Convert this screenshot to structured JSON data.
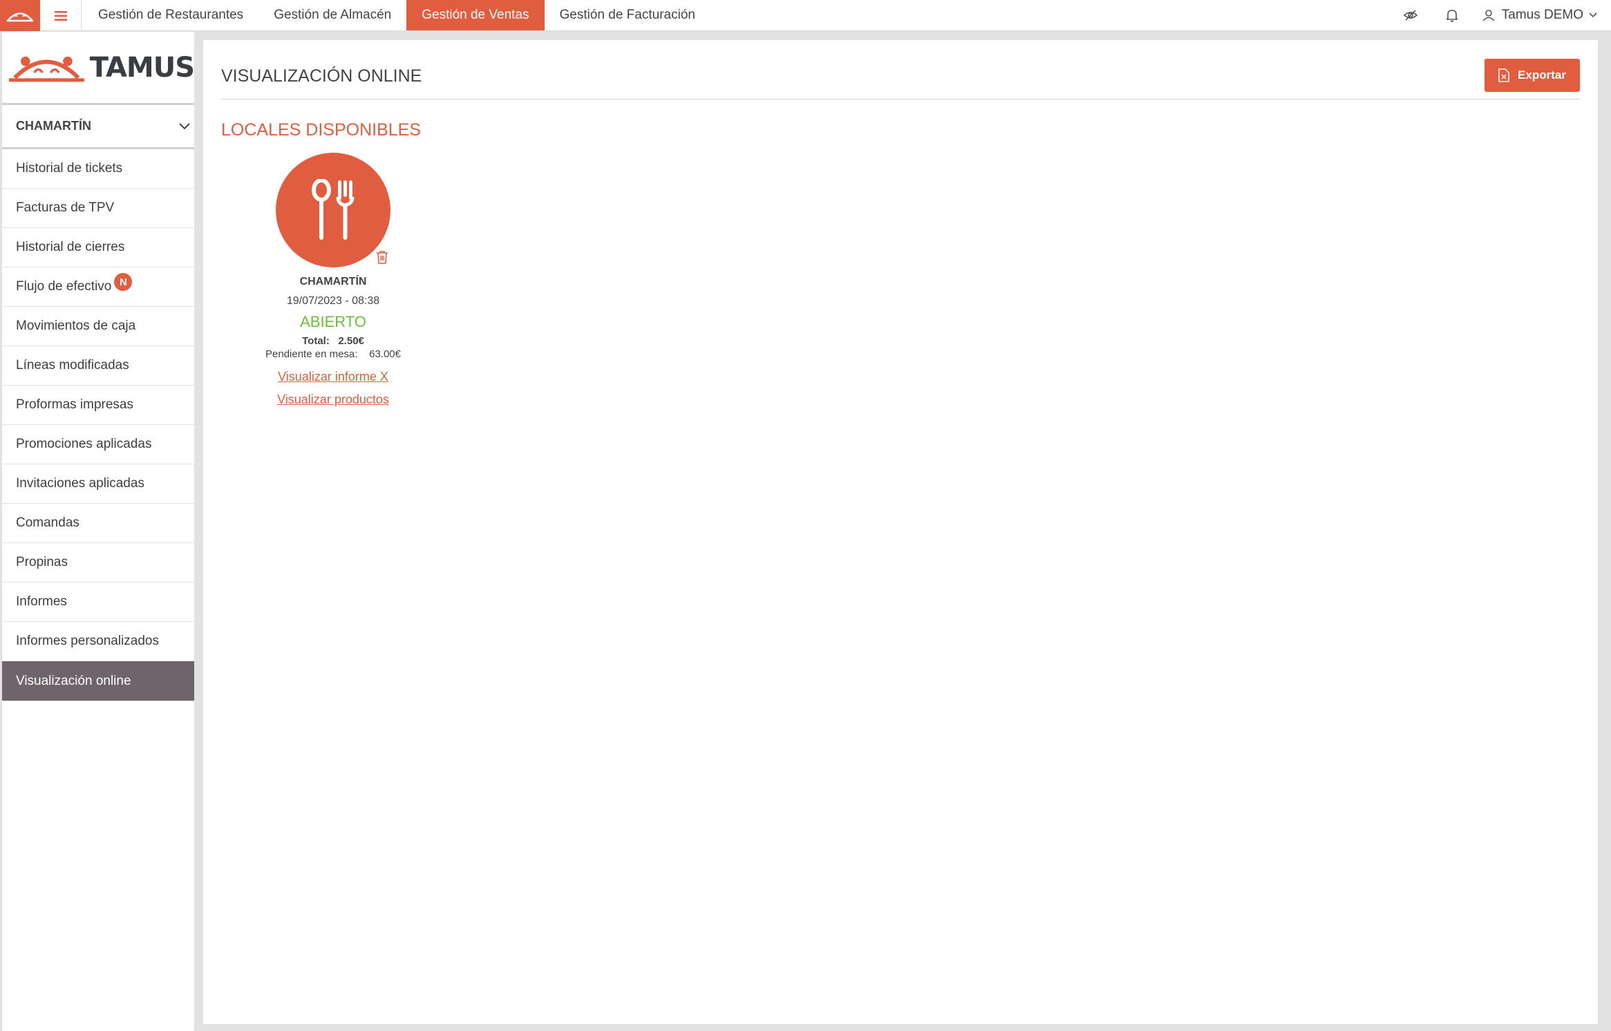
{
  "colors": {
    "accent": "#e05d3f",
    "sidebar_active": "#6f6469",
    "status_open": "#6cbf3a"
  },
  "topbar": {
    "nav": [
      {
        "label": "Gestión de Restaurantes"
      },
      {
        "label": "Gestión de Almacén"
      },
      {
        "label": "Gestión de Ventas",
        "active": true
      },
      {
        "label": "Gestión de Facturación"
      }
    ],
    "user_name": "Tamus DEMO",
    "icons": [
      "eye-slash-icon",
      "bell-icon",
      "user-icon",
      "chevron-down-icon"
    ]
  },
  "sidebar": {
    "brand_name": "TAMUS",
    "location": "CHAMARTÍN",
    "items": [
      {
        "label": "Historial de tickets"
      },
      {
        "label": "Facturas de TPV"
      },
      {
        "label": "Historial de cierres"
      },
      {
        "label": "Flujo de efectivo",
        "badge": "N"
      },
      {
        "label": "Movimientos de caja"
      },
      {
        "label": "Líneas modificadas"
      },
      {
        "label": "Proformas impresas"
      },
      {
        "label": "Promociones aplicadas"
      },
      {
        "label": "Invitaciones aplicadas"
      },
      {
        "label": "Comandas"
      },
      {
        "label": "Propinas"
      },
      {
        "label": "Informes"
      },
      {
        "label": "Informes personalizados"
      },
      {
        "label": "Visualización online",
        "active": true
      }
    ]
  },
  "main": {
    "title": "VISUALIZACIÓN ONLINE",
    "export_label": "Exportar",
    "section_title": "LOCALES DISPONIBLES",
    "store": {
      "name": "CHAMARTÍN",
      "datetime": "19/07/2023 - 08:38",
      "status": "ABIERTO",
      "total_label": "Total:",
      "total_value": "2.50€",
      "pending_label": "Pendiente en mesa:",
      "pending_value": "63.00€",
      "link_report": "Visualizar informe X",
      "link_products": "Visualizar productos"
    }
  }
}
